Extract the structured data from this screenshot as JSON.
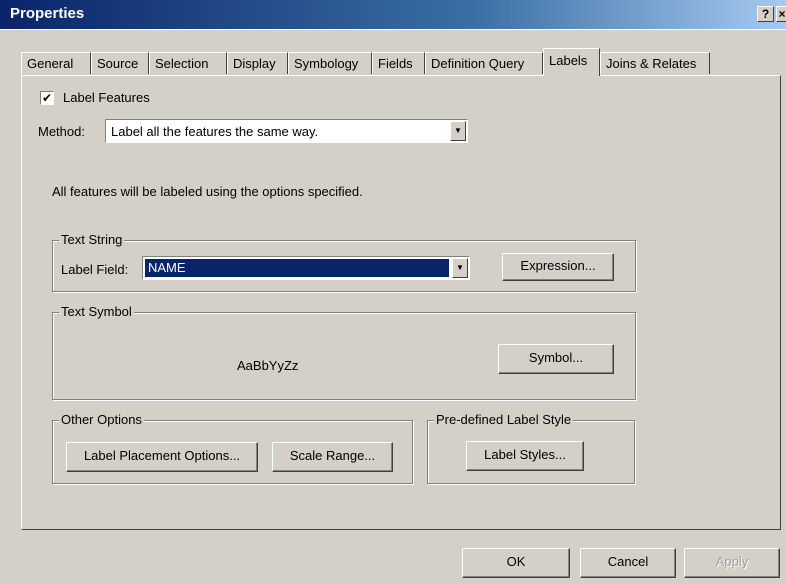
{
  "window": {
    "title": "Properties",
    "help_label": "?",
    "close_label": "×"
  },
  "tabs": [
    {
      "label": "General"
    },
    {
      "label": "Source"
    },
    {
      "label": "Selection"
    },
    {
      "label": "Display"
    },
    {
      "label": "Symbology"
    },
    {
      "label": "Fields"
    },
    {
      "label": "Definition Query"
    },
    {
      "label": "Labels",
      "active": true
    },
    {
      "label": "Joins & Relates"
    }
  ],
  "labels_tab": {
    "label_features": {
      "label": "Label Features",
      "checked": true,
      "mark": "✔"
    },
    "method": {
      "label": "Method:",
      "value": "Label all the features the same way."
    },
    "description": "All features will be labeled using the options specified.",
    "text_string": {
      "title": "Text String",
      "field_label": "Label Field:",
      "field_value": "NAME",
      "expression_button": "Expression..."
    },
    "text_symbol": {
      "title": "Text Symbol",
      "preview": "AaBbYyZz",
      "symbol_button": "Symbol..."
    },
    "other_options": {
      "title": "Other Options",
      "placement_button": "Label Placement Options...",
      "scale_button": "Scale Range..."
    },
    "predefined_style": {
      "title": "Pre-defined Label Style",
      "styles_button": "Label Styles..."
    }
  },
  "footer": {
    "ok": "OK",
    "cancel": "Cancel",
    "apply": "Apply"
  },
  "icons": {
    "dropdown_arrow": "▼"
  }
}
